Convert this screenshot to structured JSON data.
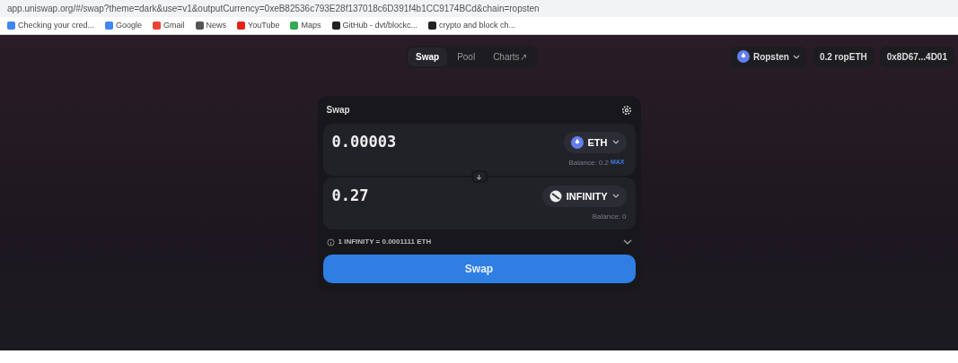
{
  "browser": {
    "url": "app.uniswap.org/#/swap?theme=dark&use=v1&outputCurrency=0xeB82536c793E28f137018c6D391f4b1CC9174BCd&chain=ropsten",
    "bookmarks": [
      {
        "label": "Checking your cred..."
      },
      {
        "label": "Google"
      },
      {
        "label": "Gmail"
      },
      {
        "label": "News"
      },
      {
        "label": "YouTube"
      },
      {
        "label": "Maps"
      },
      {
        "label": "GitHub - dvt/blockc..."
      },
      {
        "label": "crypto and block ch..."
      }
    ]
  },
  "nav": {
    "tabs": [
      {
        "label": "Swap",
        "selected": true
      },
      {
        "label": "Pool",
        "selected": false
      },
      {
        "label": "Charts↗",
        "selected": false
      }
    ]
  },
  "network": {
    "label": "Ropsten"
  },
  "balance": "0.2 ropETH",
  "account": "0x8D67...4D01",
  "swap": {
    "title": "Swap",
    "inputs": [
      {
        "amount": "0.00003",
        "token": "ETH",
        "balance": "Balance: 0.2",
        "max": "MAX"
      },
      {
        "amount": "0.27",
        "token": "INFINITY",
        "balance": "Balance: 0"
      }
    ],
    "rate": "1 INFINITY = 0.0001111 ETH",
    "button": "Swap"
  }
}
